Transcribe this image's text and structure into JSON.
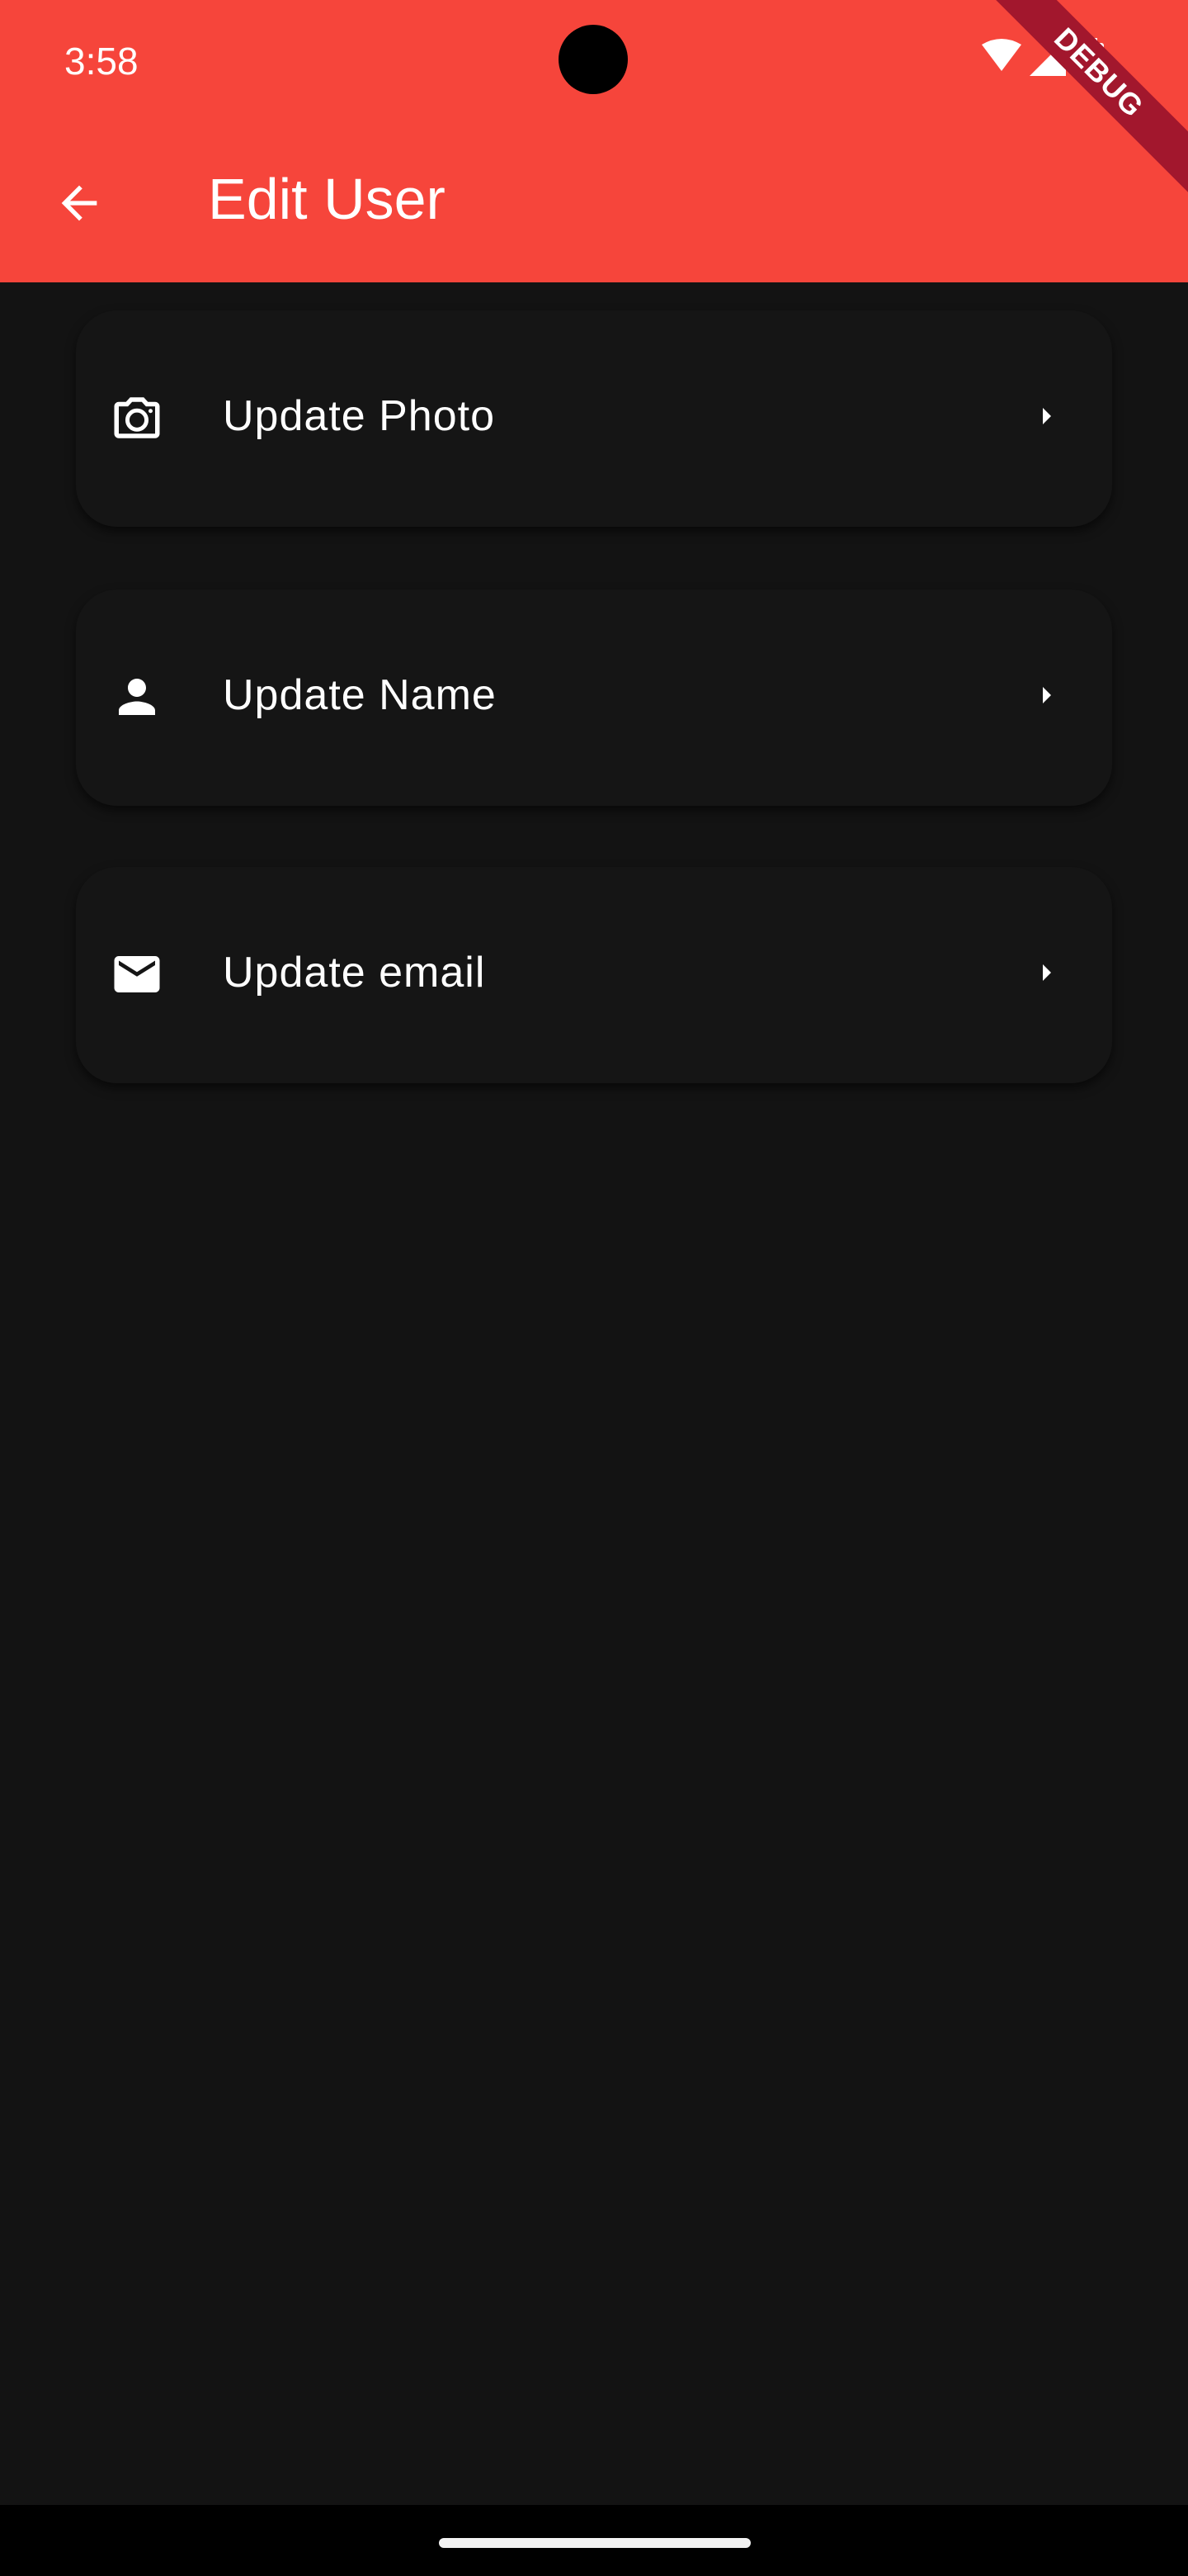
{
  "status_bar": {
    "time": "3:58",
    "icons": [
      "wifi-icon",
      "cellular-signal-icon",
      "battery-icon"
    ]
  },
  "debug_banner": {
    "label": "DEBUG"
  },
  "app_bar": {
    "title": "Edit User",
    "back_icon": "arrow-back-icon",
    "background_color": "#f6453b"
  },
  "menu": {
    "items": [
      {
        "label": "Update Photo",
        "icon": "camera-icon",
        "trailing_icon": "arrow-right-icon"
      },
      {
        "label": "Update Name",
        "icon": "person-icon",
        "trailing_icon": "arrow-right-icon"
      },
      {
        "label": "Update email",
        "icon": "email-icon",
        "trailing_icon": "arrow-right-icon"
      }
    ]
  },
  "colors": {
    "background": "#131313",
    "card": "#151515",
    "text": "#ffffff"
  }
}
